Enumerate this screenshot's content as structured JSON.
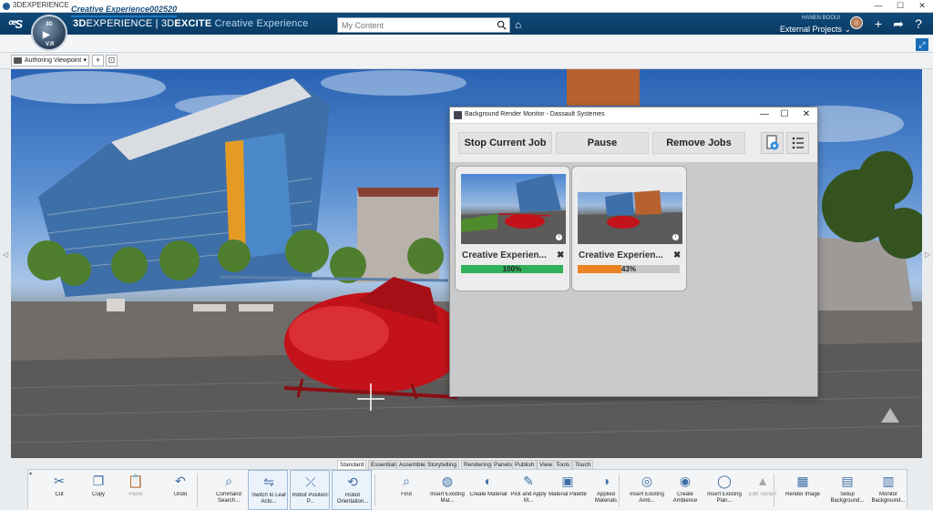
{
  "os_window": {
    "title": "3DEXPERIENCE",
    "min": "—",
    "max": "☐",
    "close": "✕"
  },
  "header": {
    "brand_prefix": "3D",
    "brand_main": "EXPERIENCE | 3D",
    "brand_strong": "EXCITE",
    "app_name": "Creative Experience",
    "compass_top": "3D",
    "compass_bottom": "V.R",
    "search_placeholder": "My Content",
    "user_name": "HANEN BOOUI",
    "workspace": "External Projects",
    "workspace_arrow": "⌄"
  },
  "tabs": {
    "active": "Creative Experience002520",
    "add": "+"
  },
  "viewpoint": {
    "label": "Authoring Viewpoint",
    "arrow": "▾",
    "add": "+",
    "capture": "⊡"
  },
  "dialog": {
    "title": "Background Render Monitor - Dassault Systemes",
    "min": "—",
    "max": "☐",
    "close": "✕",
    "stop_label": "Stop Current Job",
    "pause_label": "Pause",
    "remove_label": "Remove Jobs",
    "jobs": [
      {
        "name": "Creative Experien...",
        "close": "✖",
        "progress": 100,
        "percent_label": "100%",
        "bar_color": "#2fb15a"
      },
      {
        "name": "Creative Experien...",
        "close": "✖",
        "progress": 43,
        "percent_label": "43%",
        "bar_color": "#ea8322"
      }
    ]
  },
  "section_tabs": [
    "Standard",
    "Essentials",
    "Assemble",
    "Storytelling",
    "Rendering",
    "Panels",
    "Publish",
    "View",
    "Tools",
    "Touch"
  ],
  "section_active": "Standard",
  "actions": [
    {
      "label": "Cut",
      "icon": "scissors-icon"
    },
    {
      "label": "Copy",
      "icon": "copy-icon"
    },
    {
      "label": "Paste",
      "icon": "paste-icon",
      "disabled": true
    },
    {
      "label": "Undo",
      "icon": "undo-icon"
    },
    {
      "label": "Command Search...",
      "icon": "command-search-icon"
    },
    {
      "label": "Switch to Leaf Acto...",
      "icon": "switch-leaf-icon"
    },
    {
      "label": "Robot Position: P...",
      "icon": "robot-position-icon"
    },
    {
      "label": "Robot Orientation...",
      "icon": "robot-orientation-icon"
    },
    {
      "label": "Find",
      "icon": "find-icon"
    },
    {
      "label": "Insert Existing Mat...",
      "icon": "insert-material-icon"
    },
    {
      "label": "Create Material",
      "icon": "create-material-icon"
    },
    {
      "label": "Pick and Apply M...",
      "icon": "pick-apply-icon"
    },
    {
      "label": "Material Palette",
      "icon": "material-palette-icon"
    },
    {
      "label": "Applied Materials",
      "icon": "applied-materials-icon"
    },
    {
      "label": "Insert Existing Amb...",
      "icon": "insert-ambience-icon"
    },
    {
      "label": "Create Ambience",
      "icon": "create-ambience-icon"
    },
    {
      "label": "Insert Existing Plan...",
      "icon": "insert-planet-icon"
    },
    {
      "label": "Edit Terrain",
      "icon": "edit-terrain-icon",
      "disabled": true
    },
    {
      "label": "Render Image",
      "icon": "render-image-icon"
    },
    {
      "label": "Setup Background...",
      "icon": "setup-background-icon"
    },
    {
      "label": "Monitor Background...",
      "icon": "monitor-background-icon"
    }
  ],
  "colors": {
    "header_blue": "#0e4b7c",
    "accent": "#1a79c4",
    "helicopter_red": "#c4121a"
  }
}
